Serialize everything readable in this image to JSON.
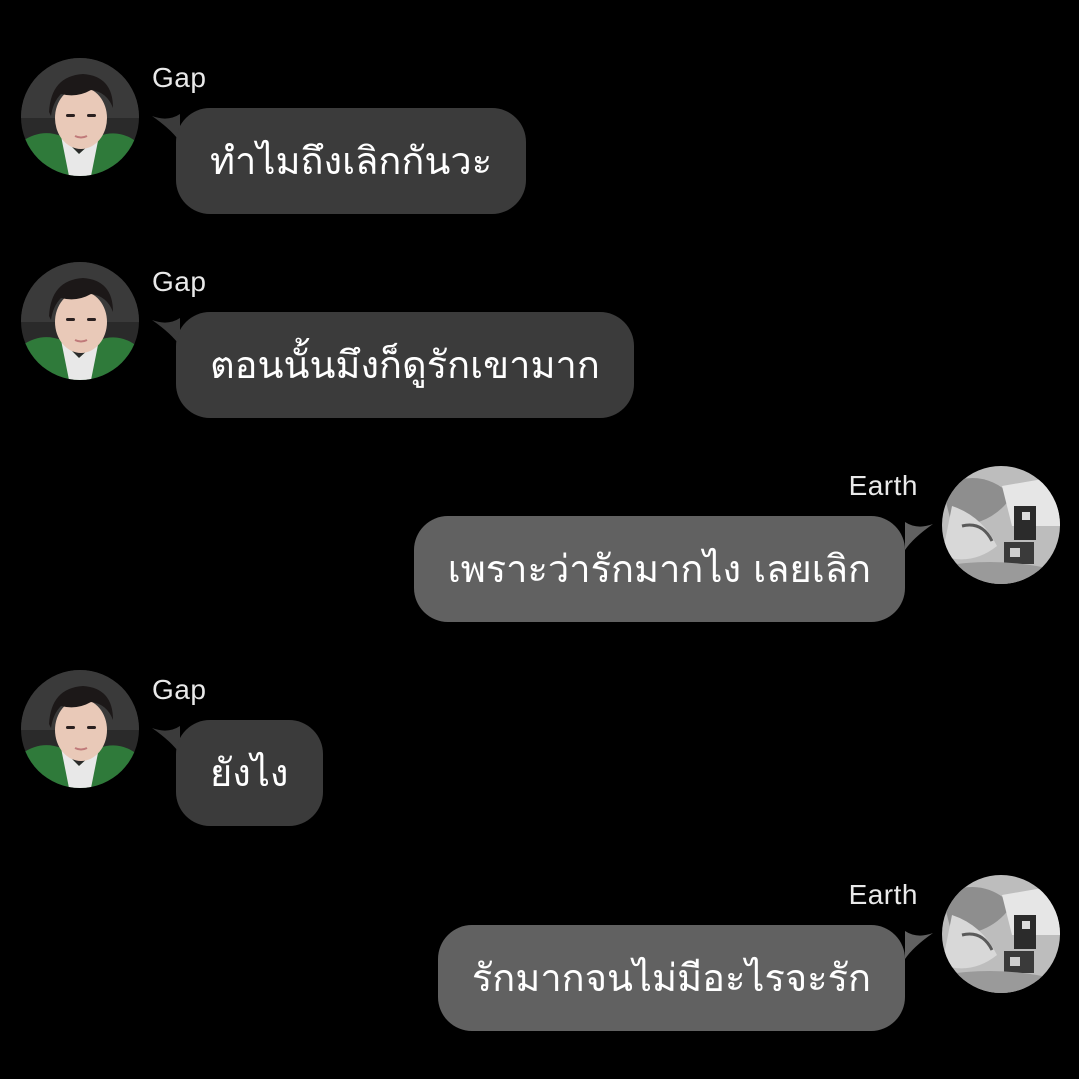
{
  "colors": {
    "background": "#000000",
    "bubble_gap": "#3b3b3b",
    "bubble_earth": "#616161",
    "text": "#ffffff",
    "name_text": "#e9e9e9"
  },
  "messages": [
    {
      "sender": "Gap",
      "avatar": "gap-avatar-icon",
      "text": "ทำไมถึงเลิกกันวะ"
    },
    {
      "sender": "Gap",
      "avatar": "gap-avatar-icon",
      "text": "ตอนนั้นมึงก็ดูรักเขามาก"
    },
    {
      "sender": "Earth",
      "avatar": "earth-avatar-icon",
      "text": "เพราะว่ารักมากไง เลยเลิก"
    },
    {
      "sender": "Gap",
      "avatar": "gap-avatar-icon",
      "text": "ยังไง"
    },
    {
      "sender": "Earth",
      "avatar": "earth-avatar-icon",
      "text": "รักมากจนไม่มีอะไรจะรัก"
    }
  ]
}
